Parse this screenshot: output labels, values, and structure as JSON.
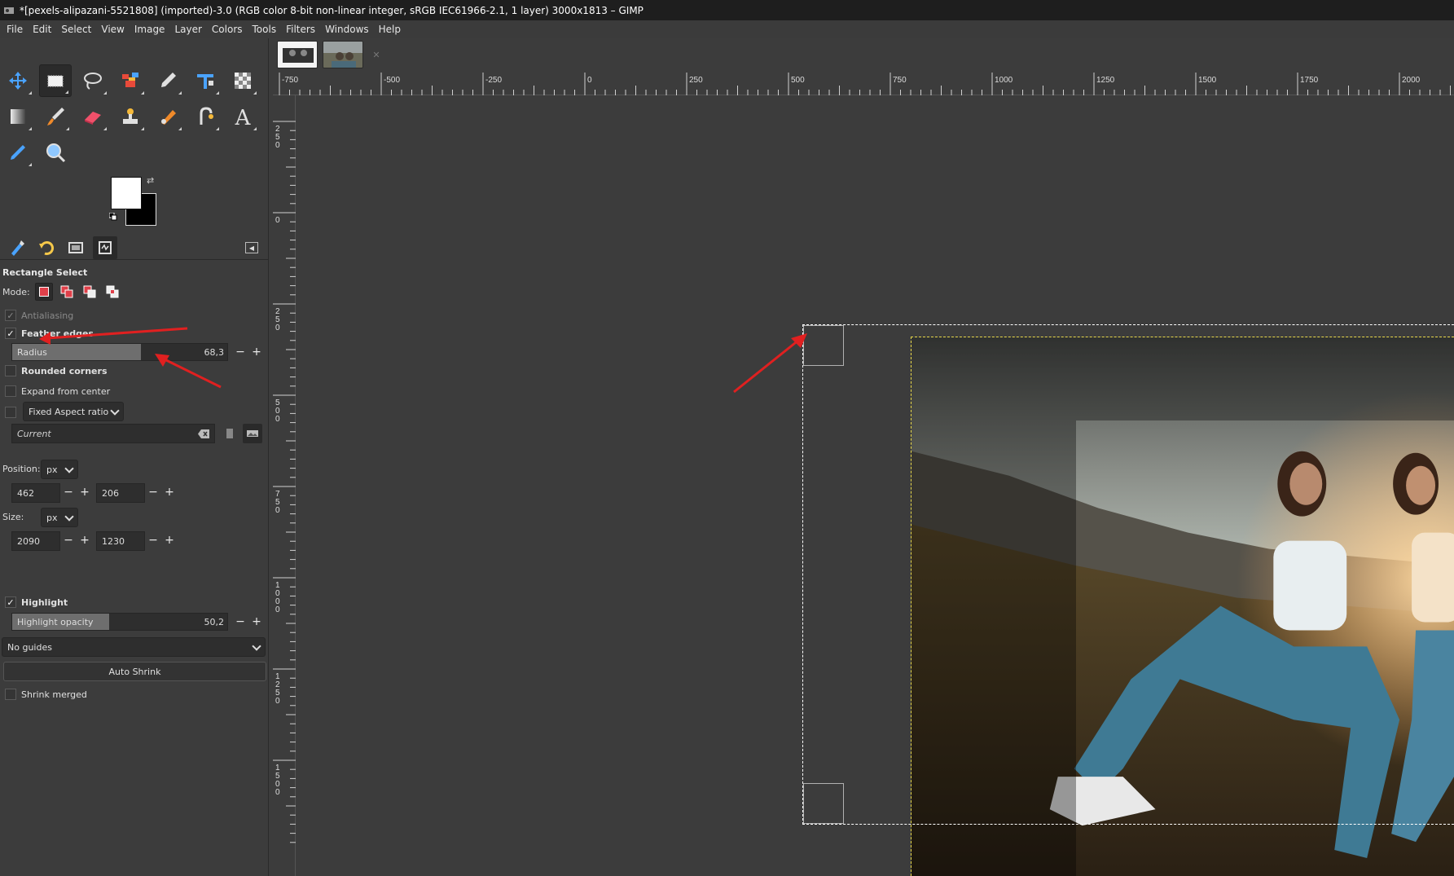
{
  "window": {
    "title": "*[pexels-alipazani-5521808] (imported)-3.0 (RGB color 8-bit non-linear integer, sRGB IEC61966-2.1, 1 layer) 3000x1813 – GIMP"
  },
  "menubar": {
    "items": [
      "File",
      "Edit",
      "Select",
      "View",
      "Image",
      "Layer",
      "Colors",
      "Tools",
      "Filters",
      "Windows",
      "Help"
    ]
  },
  "toolbox": {
    "tools": [
      {
        "name": "move-tool-icon",
        "active": false
      },
      {
        "name": "rectangle-select-tool-icon",
        "active": true
      },
      {
        "name": "free-select-tool-icon",
        "active": false
      },
      {
        "name": "foreground-select-tool-icon",
        "active": false
      },
      {
        "name": "paths-tool-icon",
        "active": false
      },
      {
        "name": "unified-transform-tool-icon",
        "active": false
      },
      {
        "name": "cage-transform-tool-icon",
        "active": false
      },
      {
        "name": "gradient-tool-icon",
        "active": false
      },
      {
        "name": "paintbrush-tool-icon",
        "active": false
      },
      {
        "name": "eraser-tool-icon",
        "active": false
      },
      {
        "name": "clone-tool-icon",
        "active": false
      },
      {
        "name": "smudge-tool-icon",
        "active": false
      },
      {
        "name": "dodge-burn-tool-icon",
        "active": false
      },
      {
        "name": "text-tool-icon",
        "active": false
      },
      {
        "name": "color-picker-tool-icon",
        "active": false
      },
      {
        "name": "zoom-tool-icon",
        "active": false
      }
    ],
    "foreground_color": "#ffffff",
    "background_color": "#000000"
  },
  "dock": {
    "tabs": [
      "tool-options-tab-icon",
      "undo-history-tab-icon",
      "images-tab-icon",
      "device-status-tab-icon"
    ]
  },
  "tool_options": {
    "title": "Rectangle Select",
    "mode_label": "Mode:",
    "antialiasing": {
      "label": "Antialiasing",
      "checked": true,
      "enabled": false
    },
    "feather_edges": {
      "label": "Feather edges",
      "checked": true
    },
    "radius": {
      "label": "Radius",
      "value": "68,3",
      "fraction": 0.6
    },
    "rounded_corners": {
      "label": "Rounded corners",
      "checked": false
    },
    "expand_from_center": {
      "label": "Expand from center",
      "checked": false
    },
    "fixed": {
      "checked": false,
      "selected": "Fixed Aspect ratio"
    },
    "current_placeholder": "Current",
    "position_label": "Position:",
    "position_unit": "px",
    "position_x": "462",
    "position_y": "206",
    "size_label": "Size:",
    "size_unit": "px",
    "size_w": "2090",
    "size_h": "1230",
    "highlight": {
      "label": "Highlight",
      "checked": true
    },
    "highlight_opacity": {
      "label": "Highlight opacity",
      "value": "50,2",
      "fraction": 0.45
    },
    "guides": "No guides",
    "auto_shrink": "Auto Shrink",
    "shrink_merged": {
      "label": "Shrink merged",
      "checked": false
    }
  },
  "ruler_h": {
    "labels": [
      "-750",
      "-500",
      "-250",
      "0",
      "250",
      "500",
      "750",
      "1000",
      "1250",
      "1500",
      "1750",
      "2000"
    ]
  },
  "ruler_v": {
    "labels": [
      "250",
      "0",
      "250",
      "500",
      "750",
      "1000",
      "1250",
      "1500"
    ]
  },
  "colors": {
    "annotation_arrow": "#e02020",
    "selection_border": "#ffffff",
    "layer_border": "#e8d84a"
  }
}
